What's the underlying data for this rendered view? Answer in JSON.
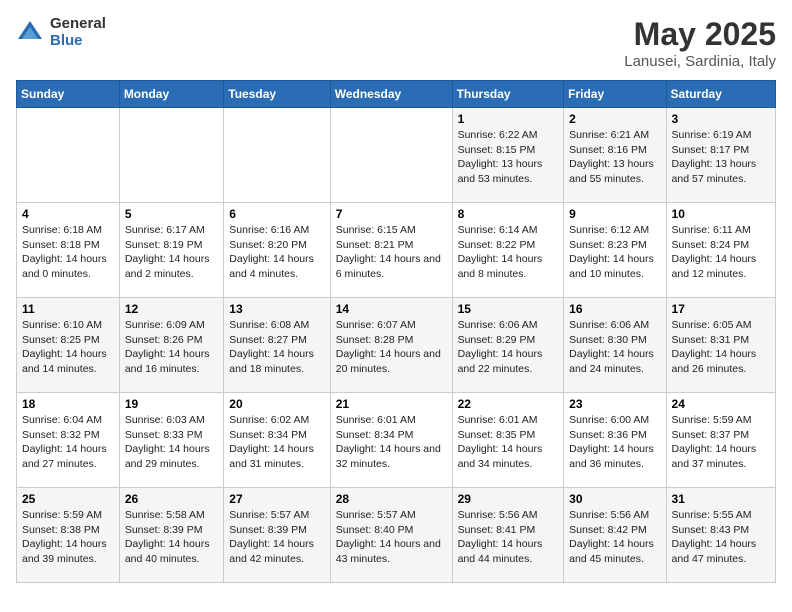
{
  "logo": {
    "general": "General",
    "blue": "Blue"
  },
  "title": "May 2025",
  "subtitle": "Lanusei, Sardinia, Italy",
  "days_of_week": [
    "Sunday",
    "Monday",
    "Tuesday",
    "Wednesday",
    "Thursday",
    "Friday",
    "Saturday"
  ],
  "weeks": [
    [
      {
        "day": "",
        "content": ""
      },
      {
        "day": "",
        "content": ""
      },
      {
        "day": "",
        "content": ""
      },
      {
        "day": "",
        "content": ""
      },
      {
        "day": "1",
        "content": "Sunrise: 6:22 AM\nSunset: 8:15 PM\nDaylight: 13 hours\nand 53 minutes."
      },
      {
        "day": "2",
        "content": "Sunrise: 6:21 AM\nSunset: 8:16 PM\nDaylight: 13 hours\nand 55 minutes."
      },
      {
        "day": "3",
        "content": "Sunrise: 6:19 AM\nSunset: 8:17 PM\nDaylight: 13 hours\nand 57 minutes."
      }
    ],
    [
      {
        "day": "4",
        "content": "Sunrise: 6:18 AM\nSunset: 8:18 PM\nDaylight: 14 hours\nand 0 minutes."
      },
      {
        "day": "5",
        "content": "Sunrise: 6:17 AM\nSunset: 8:19 PM\nDaylight: 14 hours\nand 2 minutes."
      },
      {
        "day": "6",
        "content": "Sunrise: 6:16 AM\nSunset: 8:20 PM\nDaylight: 14 hours\nand 4 minutes."
      },
      {
        "day": "7",
        "content": "Sunrise: 6:15 AM\nSunset: 8:21 PM\nDaylight: 14 hours\nand 6 minutes."
      },
      {
        "day": "8",
        "content": "Sunrise: 6:14 AM\nSunset: 8:22 PM\nDaylight: 14 hours\nand 8 minutes."
      },
      {
        "day": "9",
        "content": "Sunrise: 6:12 AM\nSunset: 8:23 PM\nDaylight: 14 hours\nand 10 minutes."
      },
      {
        "day": "10",
        "content": "Sunrise: 6:11 AM\nSunset: 8:24 PM\nDaylight: 14 hours\nand 12 minutes."
      }
    ],
    [
      {
        "day": "11",
        "content": "Sunrise: 6:10 AM\nSunset: 8:25 PM\nDaylight: 14 hours\nand 14 minutes."
      },
      {
        "day": "12",
        "content": "Sunrise: 6:09 AM\nSunset: 8:26 PM\nDaylight: 14 hours\nand 16 minutes."
      },
      {
        "day": "13",
        "content": "Sunrise: 6:08 AM\nSunset: 8:27 PM\nDaylight: 14 hours\nand 18 minutes."
      },
      {
        "day": "14",
        "content": "Sunrise: 6:07 AM\nSunset: 8:28 PM\nDaylight: 14 hours\nand 20 minutes."
      },
      {
        "day": "15",
        "content": "Sunrise: 6:06 AM\nSunset: 8:29 PM\nDaylight: 14 hours\nand 22 minutes."
      },
      {
        "day": "16",
        "content": "Sunrise: 6:06 AM\nSunset: 8:30 PM\nDaylight: 14 hours\nand 24 minutes."
      },
      {
        "day": "17",
        "content": "Sunrise: 6:05 AM\nSunset: 8:31 PM\nDaylight: 14 hours\nand 26 minutes."
      }
    ],
    [
      {
        "day": "18",
        "content": "Sunrise: 6:04 AM\nSunset: 8:32 PM\nDaylight: 14 hours\nand 27 minutes."
      },
      {
        "day": "19",
        "content": "Sunrise: 6:03 AM\nSunset: 8:33 PM\nDaylight: 14 hours\nand 29 minutes."
      },
      {
        "day": "20",
        "content": "Sunrise: 6:02 AM\nSunset: 8:34 PM\nDaylight: 14 hours\nand 31 minutes."
      },
      {
        "day": "21",
        "content": "Sunrise: 6:01 AM\nSunset: 8:34 PM\nDaylight: 14 hours\nand 32 minutes."
      },
      {
        "day": "22",
        "content": "Sunrise: 6:01 AM\nSunset: 8:35 PM\nDaylight: 14 hours\nand 34 minutes."
      },
      {
        "day": "23",
        "content": "Sunrise: 6:00 AM\nSunset: 8:36 PM\nDaylight: 14 hours\nand 36 minutes."
      },
      {
        "day": "24",
        "content": "Sunrise: 5:59 AM\nSunset: 8:37 PM\nDaylight: 14 hours\nand 37 minutes."
      }
    ],
    [
      {
        "day": "25",
        "content": "Sunrise: 5:59 AM\nSunset: 8:38 PM\nDaylight: 14 hours\nand 39 minutes."
      },
      {
        "day": "26",
        "content": "Sunrise: 5:58 AM\nSunset: 8:39 PM\nDaylight: 14 hours\nand 40 minutes."
      },
      {
        "day": "27",
        "content": "Sunrise: 5:57 AM\nSunset: 8:39 PM\nDaylight: 14 hours\nand 42 minutes."
      },
      {
        "day": "28",
        "content": "Sunrise: 5:57 AM\nSunset: 8:40 PM\nDaylight: 14 hours\nand 43 minutes."
      },
      {
        "day": "29",
        "content": "Sunrise: 5:56 AM\nSunset: 8:41 PM\nDaylight: 14 hours\nand 44 minutes."
      },
      {
        "day": "30",
        "content": "Sunrise: 5:56 AM\nSunset: 8:42 PM\nDaylight: 14 hours\nand 45 minutes."
      },
      {
        "day": "31",
        "content": "Sunrise: 5:55 AM\nSunset: 8:43 PM\nDaylight: 14 hours\nand 47 minutes."
      }
    ]
  ]
}
